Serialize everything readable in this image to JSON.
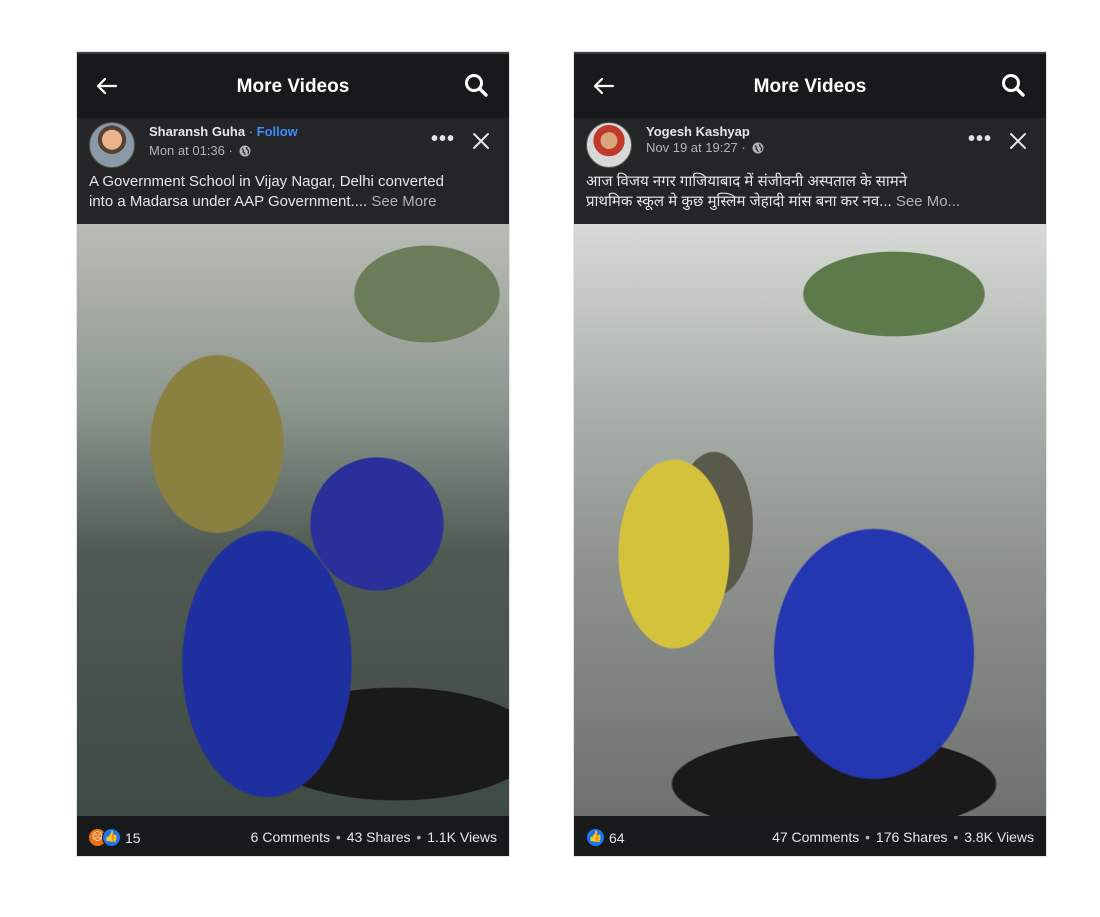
{
  "left": {
    "header_title": "More Videos",
    "author": "Sharansh Guha",
    "author_sep": " · ",
    "follow": "Follow",
    "time": "Mon at 01:36 · ",
    "caption_line1": "A Government School in Vijay Nagar, Delhi converted",
    "caption_line2": "into a Madarsa under AAP Government....",
    "see_more": " See More",
    "reaction_count": "15",
    "comments": "6 Comments",
    "shares": "43 Shares",
    "views": "1.1K Views"
  },
  "right": {
    "header_title": "More Videos",
    "author": "Yogesh Kashyap",
    "time": "Nov 19 at 19:27 · ",
    "caption_line1": "आज विजय नगर गाजियाबाद में संजीवनी अस्पताल के सामने",
    "caption_line2": "प्राथमिक स्कूल मे कुछ मुस्लिम जेहादी मांस बना कर नव...",
    "see_more": " See Mo...",
    "reaction_count": "64",
    "comments": "47 Comments",
    "shares": "176 Shares",
    "views": "3.8K Views"
  },
  "dot_sep": "•",
  "colors": {
    "background": "#18191a",
    "post_background": "#242526",
    "text": "#e4e6eb",
    "muted": "#b0b3b8",
    "link": "#3d8bff",
    "like": "#1877f2",
    "angry": "#e9710f"
  }
}
